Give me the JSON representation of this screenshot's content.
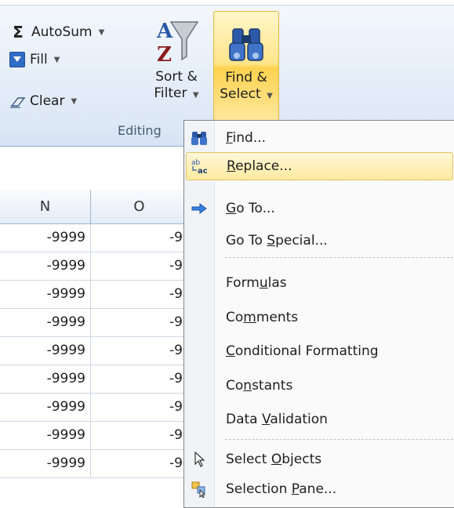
{
  "ribbon": {
    "autosum_label": "AutoSum",
    "fill_label": "Fill",
    "clear_label": "Clear",
    "sort_label_line1": "Sort &",
    "sort_label_line2": "Filter",
    "find_label_line1": "Find &",
    "find_label_line2": "Select",
    "group_label": "Editing",
    "icons": {
      "autosum": "sigma-icon",
      "fill": "fill-down-icon",
      "clear": "eraser-icon",
      "sort": "sort-filter-icon",
      "find": "binoculars-icon"
    },
    "colors": {
      "find_highlight": "#ffd24f",
      "ribbon_bg": "#dde8f6"
    }
  },
  "grid": {
    "columns": [
      "N",
      "O"
    ],
    "rows": [
      [
        "-9999",
        "-9"
      ],
      [
        "-9999",
        "-9"
      ],
      [
        "-9999",
        "-9"
      ],
      [
        "-9999",
        "-9"
      ],
      [
        "-9999",
        "-9"
      ],
      [
        "-9999",
        "-9"
      ],
      [
        "-9999",
        "-9"
      ],
      [
        "-9999",
        "-9"
      ],
      [
        "-9999",
        "-9"
      ]
    ]
  },
  "menu": {
    "items": [
      {
        "pre": "",
        "key": "F",
        "post": "ind...",
        "icon": "binoculars-icon"
      },
      {
        "pre": "",
        "key": "R",
        "post": "eplace...",
        "icon": "replace-icon",
        "highlighted": true
      },
      {
        "pre": "",
        "key": "G",
        "post": "o To...",
        "icon": "arrow-right-icon"
      },
      {
        "pre": "Go To ",
        "key": "S",
        "post": "pecial...",
        "icon": ""
      },
      {
        "pre": "Form",
        "key": "u",
        "post": "las",
        "icon": ""
      },
      {
        "pre": "Co",
        "key": "m",
        "post": "ments",
        "icon": ""
      },
      {
        "pre": "",
        "key": "C",
        "post": "onditional Formatting",
        "icon": ""
      },
      {
        "pre": "Co",
        "key": "n",
        "post": "stants",
        "icon": ""
      },
      {
        "pre": "Data ",
        "key": "V",
        "post": "alidation",
        "icon": ""
      },
      {
        "pre": "Select ",
        "key": "O",
        "post": "bjects",
        "icon": "cursor-arrow-icon"
      },
      {
        "pre": "Selection ",
        "key": "P",
        "post": "ane...",
        "icon": "selection-pane-icon"
      }
    ]
  }
}
